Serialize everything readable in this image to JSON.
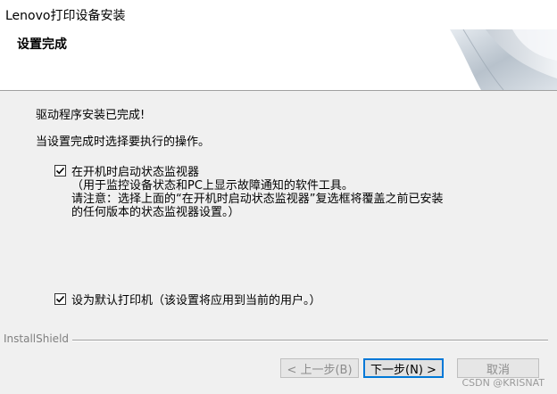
{
  "window": {
    "title": "Lenovo打印设备安装"
  },
  "header": {
    "heading": "设置完成"
  },
  "main": {
    "status_text": "驱动程序安装已完成!",
    "instruction_text": "当设置完成时选择要执行的操作。",
    "options": [
      {
        "label": "在开机时启动状态监视器",
        "checked": true,
        "note_lines": [
          "（用于监控设备状态和PC上显示故障通知的软件工具。",
          "请注意：选择上面的“在开机时启动状态监视器”复选框将覆盖之前已安装",
          "的任何版本的状态监视器设置。）"
        ]
      },
      {
        "label": "设为默认打印机（该设置将应用到当前的用户。）",
        "checked": true
      }
    ]
  },
  "footer": {
    "installer_label": "InstallShield",
    "back_label": "< 上一步(B)",
    "next_label": "下一步(N) >",
    "cancel_label": "取消"
  },
  "watermark": "CSDN @KRISNAT"
}
